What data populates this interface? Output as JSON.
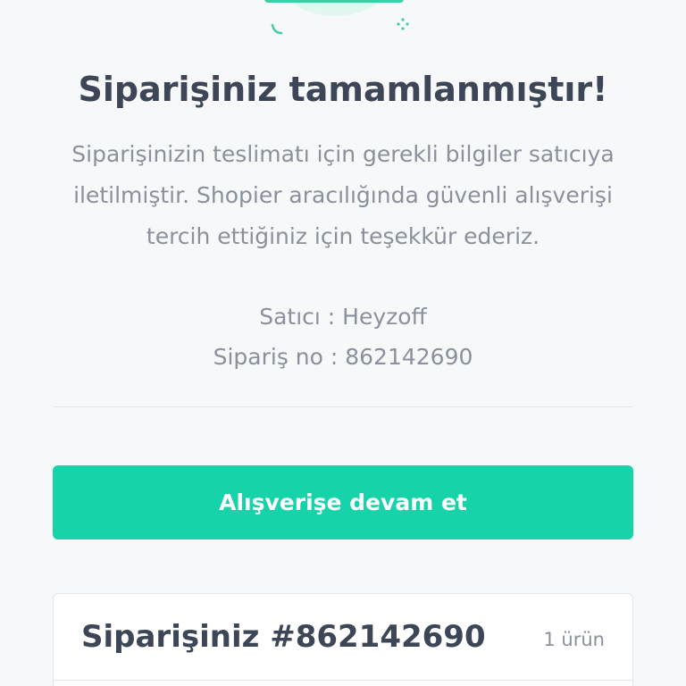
{
  "colors": {
    "accent": "#16d3a9",
    "title_text": "#3c4656",
    "muted_text": "#8a919b"
  },
  "success": {
    "icon": "success-check-illustration",
    "title": "Siparişiniz tamamlanmıştır!",
    "description": "Siparişinizin teslimatı için gerekli bilgiler satıcıya iletilmiştir. Shopier aracılığında güvenli alışverişi tercih ettiğiniz için teşekkür ederiz.",
    "seller": "Satıcı : Heyzoff",
    "order_no": "Sipariş no : 862142690"
  },
  "actions": {
    "continue_label": "Alışverişe devam et"
  },
  "order_card": {
    "title": "Siparişiniz #862142690",
    "item_count": "1 ürün"
  }
}
